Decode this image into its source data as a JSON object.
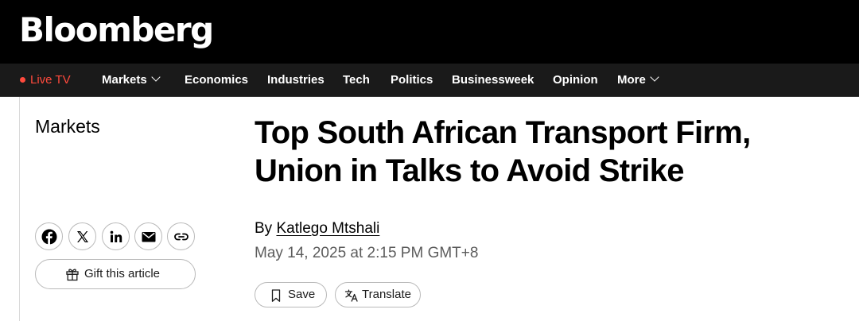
{
  "brand": {
    "logo_text": "Bloomberg"
  },
  "nav": {
    "live_tv": "Live TV",
    "markets": "Markets",
    "economics": "Economics",
    "industries": "Industries",
    "tech": "Tech",
    "politics": "Politics",
    "businessweek": "Businessweek",
    "opinion": "Opinion",
    "more": "More"
  },
  "colors": {
    "live_accent": "#ff4a3d",
    "top_bar": "#000000",
    "nav_bar": "#1a1a1a"
  },
  "article": {
    "section": "Markets",
    "headline_line1": "Top South African Transport Firm,",
    "headline_line2": "Union in Talks to Avoid Strike",
    "byline_prefix": "By ",
    "author": "Katlego Mtshali",
    "date": "May 14, 2025 at 2:15 PM GMT+8"
  },
  "share": {
    "icons": [
      "facebook-icon",
      "x-icon",
      "linkedin-icon",
      "email-icon",
      "link-icon"
    ],
    "gift_label": "Gift this article"
  },
  "actions": {
    "save_label": "Save",
    "translate_label": "Translate"
  }
}
